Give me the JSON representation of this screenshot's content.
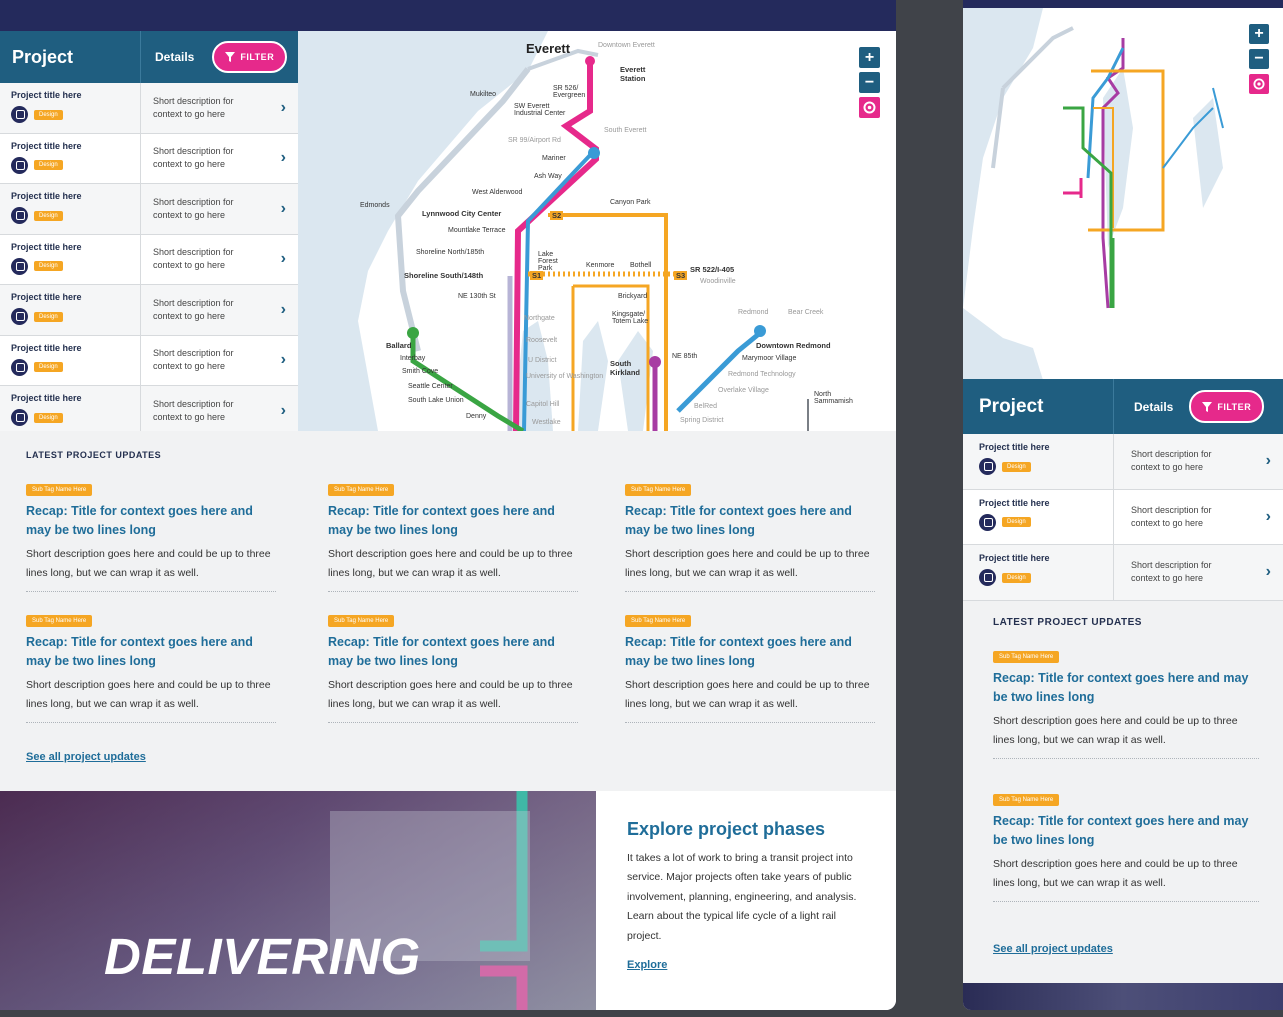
{
  "colors": {
    "navy": "#242a5c",
    "teal_header": "#1f5e80",
    "pink": "#e6298b",
    "orange_tag": "#f5a623",
    "link_blue": "#1f6d99",
    "green_line": "#3aa543",
    "blue_line": "#3a9bd6"
  },
  "table": {
    "header_project": "Project",
    "header_details": "Details",
    "filter_label": "FILTER",
    "rows": [
      {
        "title": "Project title here",
        "tag": "Design",
        "desc": "Short description for context to go here"
      },
      {
        "title": "Project title here",
        "tag": "Design",
        "desc": "Short description for context to go here"
      },
      {
        "title": "Project title here",
        "tag": "Design",
        "desc": "Short description for context to go here"
      },
      {
        "title": "Project title here",
        "tag": "Design",
        "desc": "Short description for context to go here"
      },
      {
        "title": "Project title here",
        "tag": "Design",
        "desc": "Short description for context to go here"
      },
      {
        "title": "Project title here",
        "tag": "Design",
        "desc": "Short description for context to go here"
      },
      {
        "title": "Project title here",
        "tag": "Design",
        "desc": "Short description for context to go here"
      }
    ]
  },
  "map": {
    "labels": {
      "everett": "Everett",
      "everett_station": "Everett Station",
      "downtown_everett": "Downtown Everett",
      "mukilteo": "Mukilteo",
      "sr526": "SR 526/ Evergreen",
      "swe": "SW Everett Industrial Center",
      "south_everett": "South Everett",
      "sr99": "SR 99/Airport Rd",
      "mariner": "Mariner",
      "ash_way": "Ash Way",
      "west_alderwood": "West Alderwood",
      "edmonds": "Edmonds",
      "lynnwood": "Lynnwood City Center",
      "canyon_park": "Canyon Park",
      "mountlake": "Mountlake Terrace",
      "shoreline_north": "Shoreline North/185th",
      "shoreline_south": "Shoreline South/148th",
      "lake_forest": "Lake Forest Park",
      "kenmore": "Kenmore",
      "bothell": "Bothell",
      "sr522": "SR 522/I-405",
      "woodinville": "Woodinville",
      "ne130": "NE 130th St",
      "northgate": "Northgate",
      "roosevelt": "Roosevelt",
      "ballard": "Ballard",
      "interbay": "Interbay",
      "smith_cove": "Smith Cove",
      "seattle_center": "Seattle Center",
      "south_lake_union": "South Lake Union",
      "denny": "Denny",
      "u_district": "U District",
      "uw": "University of Washington",
      "capitol_hill": "Capitol Hill",
      "westlake": "Westlake",
      "brickyard": "Brickyard",
      "kingsgate": "Kingsgate/ Totem Lake",
      "south_kirkland": "South Kirkland",
      "ne85": "NE 85th",
      "redmond": "Redmond",
      "bear_creek": "Bear Creek",
      "downtown_redmond": "Downtown Redmond",
      "marymoor": "Marymoor Village",
      "redmond_tech": "Redmond Technology",
      "overlake": "Overlake Village",
      "north_sammamish": "North Sammamish",
      "spring_district": "Spring District",
      "belred": "BelRed",
      "s1": "S1",
      "s2": "S2",
      "s3": "S3"
    }
  },
  "updates": {
    "section_title": "LATEST PROJECT UPDATES",
    "cards": [
      {
        "tag": "Sub Tag Name Here",
        "title": "Recap: Title for context goes here and may be two lines long",
        "desc": "Short description goes here and could be up to three lines long, but we can wrap it as well."
      },
      {
        "tag": "Sub Tag Name Here",
        "title": "Recap: Title for context goes here and may be two lines long",
        "desc": "Short description goes here and could be up to three lines long, but we can wrap it as well."
      },
      {
        "tag": "Sub Tag Name Here",
        "title": "Recap: Title for context goes here and may be two lines long",
        "desc": "Short description goes here and could be up to three lines long, but we can wrap it as well."
      },
      {
        "tag": "Sub Tag Name Here",
        "title": "Recap: Title for context goes here and may be two lines long",
        "desc": "Short description goes here and could be up to three lines long, but we can wrap it as well."
      },
      {
        "tag": "Sub Tag Name Here",
        "title": "Recap: Title for context goes here and may be two lines long",
        "desc": "Short description goes here and could be up to three lines long, but we can wrap it as well."
      },
      {
        "tag": "Sub Tag Name Here",
        "title": "Recap: Title for context goes here and may be two lines long",
        "desc": "Short description goes here and could be up to three lines long, but we can wrap it as well."
      }
    ],
    "see_all": "See all project updates"
  },
  "hero": {
    "word": "DELIVERING"
  },
  "explore": {
    "title": "Explore project phases",
    "body": "It takes a lot of work to bring a transit project into service. Major projects often take years of public involvement, planning, engineering, and analysis. Learn about the typical life cycle of a light rail project.",
    "link": "Explore"
  },
  "mobile": {
    "header_project": "Project",
    "header_details": "Details",
    "filter_label": "FILTER",
    "rows": [
      {
        "title": "Project title here",
        "tag": "Design",
        "desc": "Short description for context to go here"
      },
      {
        "title": "Project title here",
        "tag": "Design",
        "desc": "Short description for context to go here"
      },
      {
        "title": "Project title here",
        "tag": "Design",
        "desc": "Short description for context to go here"
      }
    ],
    "section_title": "LATEST PROJECT UPDATES",
    "cards": [
      {
        "tag": "Sub Tag Name Here",
        "title": "Recap: Title for context goes here and may be two lines long",
        "desc": "Short description goes here and could be up to three lines long, but we can wrap it as well."
      },
      {
        "tag": "Sub Tag Name Here",
        "title": "Recap: Title for context goes here and may be two lines long",
        "desc": "Short description goes here and could be up to three lines long, but we can wrap it as well."
      }
    ],
    "see_all": "See all project updates"
  },
  "icons": {
    "zoom_in": "plus-icon",
    "zoom_out": "minus-icon",
    "reset": "target-icon",
    "filter": "funnel-icon",
    "chevron": "chevron-right-icon",
    "project": "train-icon"
  }
}
